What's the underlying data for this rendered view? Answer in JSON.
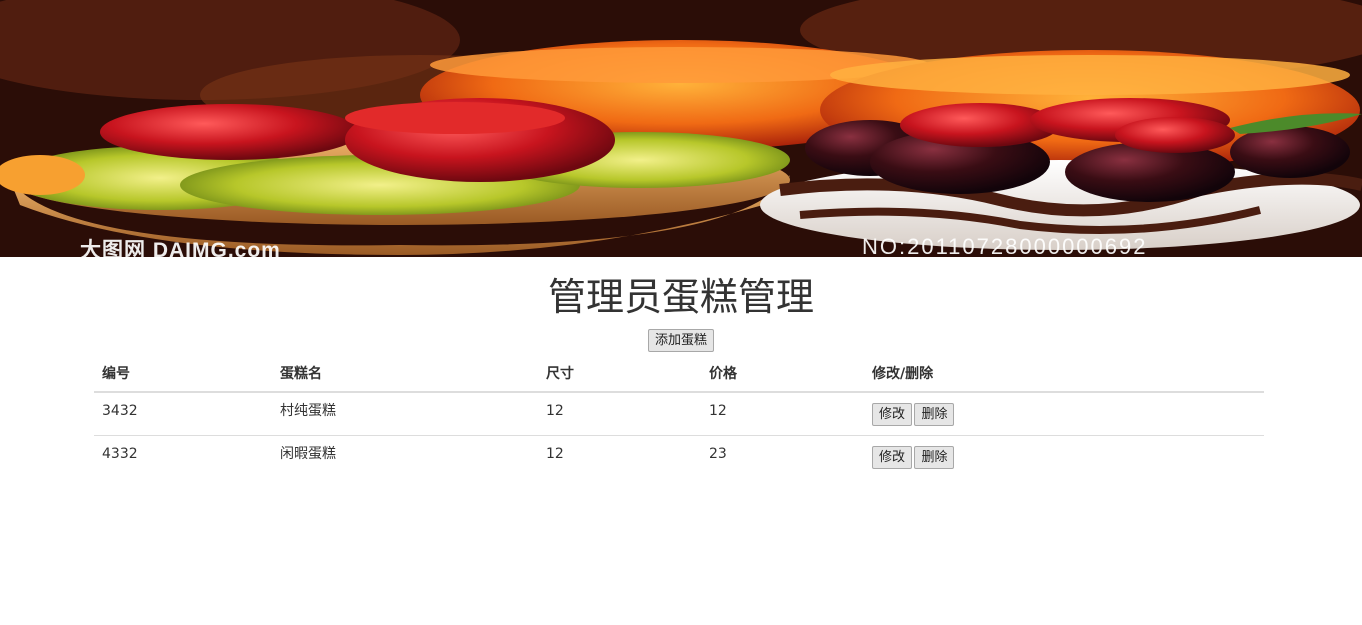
{
  "banner": {
    "watermark_left": "大图网  DAIMG.com",
    "watermark_right": "NO:20110728000000692"
  },
  "page": {
    "title": "管理员蛋糕管理",
    "add_button_label": "添加蛋糕"
  },
  "table": {
    "headers": [
      "编号",
      "蛋糕名",
      "尺寸",
      "价格",
      "修改/删除"
    ],
    "rows": [
      {
        "id": "3432",
        "name": "村纯蛋糕",
        "size": "12",
        "price": "12",
        "edit_label": "修改",
        "delete_label": "删除"
      },
      {
        "id": "4332",
        "name": "闲暇蛋糕",
        "size": "12",
        "price": "23",
        "edit_label": "修改",
        "delete_label": "删除"
      }
    ]
  },
  "colors": {
    "strawberry": "#c8141e",
    "kiwi": "#b7c72a",
    "tart_crust": "#d8964a",
    "jelly_orange": "#f06a14",
    "grape": "#3a0d14",
    "chocolate": "#4a1d10"
  }
}
